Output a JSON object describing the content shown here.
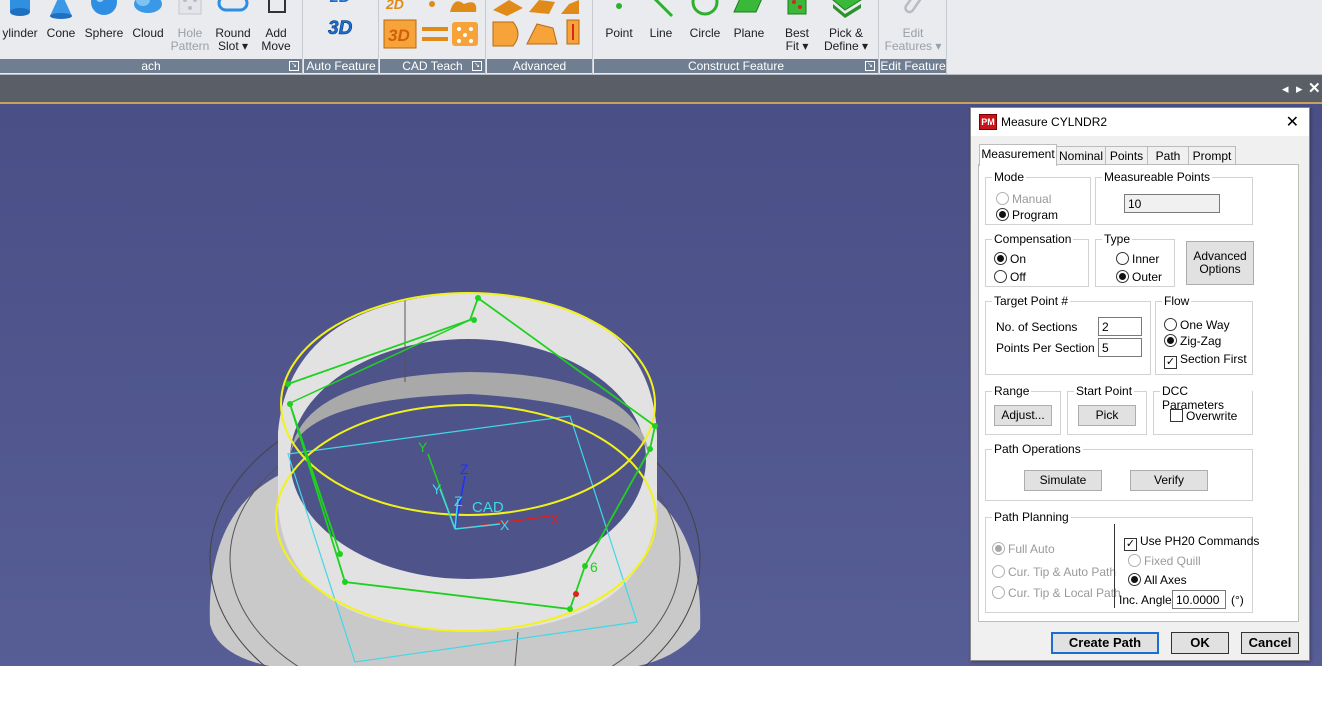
{
  "ribbon": {
    "groups": {
      "teach": {
        "label": "ach"
      },
      "auto_feature": {
        "label": "Auto Feature"
      },
      "cad_teach": {
        "label": "CAD Teach"
      },
      "advanced": {
        "label": "Advanced"
      },
      "construct_feature": {
        "label": "Construct Feature"
      },
      "edit_feature": {
        "label": "Edit Feature"
      }
    },
    "buttons": {
      "cylinder": "ylinder",
      "cone": "Cone",
      "sphere": "Sphere",
      "cloud": "Cloud",
      "hole_pattern": "Hole\nPattern",
      "round_slot": "Round\nSlot ▾",
      "add_move": "Add\nMove",
      "point": "Point",
      "line": "Line",
      "circle": "Circle",
      "plane": "Plane",
      "best_fit": "Best\nFit ▾",
      "pick_define": "Pick &\nDefine ▾",
      "edit_features": "Edit\nFeatures ▾"
    },
    "icons": {
      "label_2d": "2D",
      "label_3d": "3D"
    }
  },
  "viewport": {
    "axes": {
      "y": "Y",
      "z": "Z",
      "x": "X",
      "cad": "CAD"
    },
    "point_label": "6"
  },
  "dialog": {
    "title": "Measure CYLNDR2",
    "icon_text": "PM",
    "tabs": [
      "Measurement",
      "Nominal",
      "Points",
      "Path",
      "Prompt"
    ],
    "mode": {
      "title": "Mode",
      "manual": "Manual",
      "program": "Program",
      "selected": "Program"
    },
    "measureable_points": {
      "title": "Measureable Points",
      "value": "10"
    },
    "compensation": {
      "title": "Compensation",
      "on": "On",
      "off": "Off",
      "selected": "On"
    },
    "type": {
      "title": "Type",
      "inner": "Inner",
      "outer": "Outer",
      "selected": "Outer"
    },
    "advanced_options": "Advanced\nOptions",
    "target_point": {
      "title": "Target Point #",
      "sections_label": "No. of Sections",
      "sections_value": "2",
      "pps_label": "Points Per Section",
      "pps_value": "5"
    },
    "flow": {
      "title": "Flow",
      "one_way": "One Way",
      "zig_zag": "Zig-Zag",
      "section_first": "Section First",
      "selected": "Zig-Zag",
      "section_first_checked": true
    },
    "range": {
      "title": "Range",
      "button": "Adjust..."
    },
    "start_point": {
      "title": "Start Point",
      "button": "Pick"
    },
    "dcc": {
      "title": "DCC Parameters",
      "overwrite": "Overwrite",
      "checked": false
    },
    "path_operations": {
      "title": "Path Operations",
      "simulate": "Simulate",
      "verify": "Verify"
    },
    "path_planning": {
      "title": "Path Planning",
      "full_auto": "Full Auto",
      "cur_tip_auto": "Cur. Tip & Auto Path",
      "cur_tip_local": "Cur. Tip & Local Path",
      "use_ph20": "Use PH20 Commands",
      "use_ph20_checked": true,
      "fixed_quill": "Fixed Quill",
      "all_axes": "All Axes",
      "inc_angle_label": "Inc. Angle",
      "inc_angle_value": "10.0000",
      "inc_angle_unit": "(°)"
    },
    "buttons": {
      "create_path": "Create Path",
      "ok": "OK",
      "cancel": "Cancel"
    }
  },
  "colors": {
    "viewport": "#4d5289",
    "yellow": "#f2f21a",
    "green": "#20d020",
    "cyan": "#3fd8e8",
    "red": "#e02020",
    "dialog_icon": "#c8151b"
  }
}
